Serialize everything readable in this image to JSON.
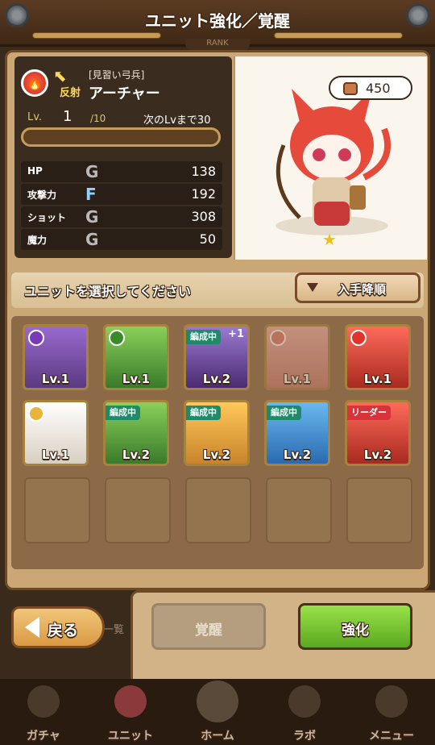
{
  "header": {
    "title": "ユニット強化／覚醒",
    "rank_label": "RANK"
  },
  "unit": {
    "counter_label": "反射",
    "subtitle": "[見習い弓兵]",
    "name": "アーチャー",
    "lv_label": "Lv.",
    "lv": "1",
    "lv_max": "/10",
    "next_lv": "次のLvまで30",
    "stats": [
      {
        "label": "HP",
        "rank": "G",
        "value": "138"
      },
      {
        "label": "攻撃力",
        "rank": "F",
        "value": "192"
      },
      {
        "label": "ショット",
        "rank": "G",
        "value": "308"
      },
      {
        "label": "魔力",
        "rank": "G",
        "value": "50"
      }
    ],
    "cost": "450"
  },
  "selection": {
    "prompt": "ユニットを選択してください",
    "sort_label": "入手降順",
    "cards": [
      {
        "lv": "Lv.1",
        "tag": "",
        "color": "#7a4aa8",
        "elem": "#7a3ab8"
      },
      {
        "lv": "Lv.1",
        "tag": "",
        "color": "#5aa83a",
        "elem": "#3a8a2a"
      },
      {
        "lv": "Lv.2",
        "tag": "編成中",
        "plus": "+1",
        "color": "#6a4aa0",
        "elem": ""
      },
      {
        "lv": "Lv.1",
        "tag": "",
        "color": "#e8a6a0",
        "elem": "#e07a6a"
      },
      {
        "lv": "Lv.1",
        "tag": "",
        "color": "#d8342a",
        "elem": "#e0342a"
      },
      {
        "lv": "Lv.1",
        "tag": "",
        "color": "#f4f0e4",
        "elem": "#e8b43a"
      },
      {
        "lv": "Lv.2",
        "tag": "編成中",
        "color": "#5aa83a",
        "elem": ""
      },
      {
        "lv": "Lv.2",
        "tag": "編成中",
        "color": "#f0a83a",
        "elem": ""
      },
      {
        "lv": "Lv.2",
        "tag": "編成中",
        "color": "#3a8ad8",
        "elem": ""
      },
      {
        "lv": "Lv.2",
        "tag": "リーダー",
        "color": "#d8342a",
        "elem": ""
      }
    ]
  },
  "buttons": {
    "back": "戻る",
    "list": "一覧",
    "awaken": "覚醒",
    "enhance": "強化"
  },
  "nav": [
    "ガチャ",
    "ユニット",
    "ホーム",
    "ラボ",
    "メニュー"
  ]
}
